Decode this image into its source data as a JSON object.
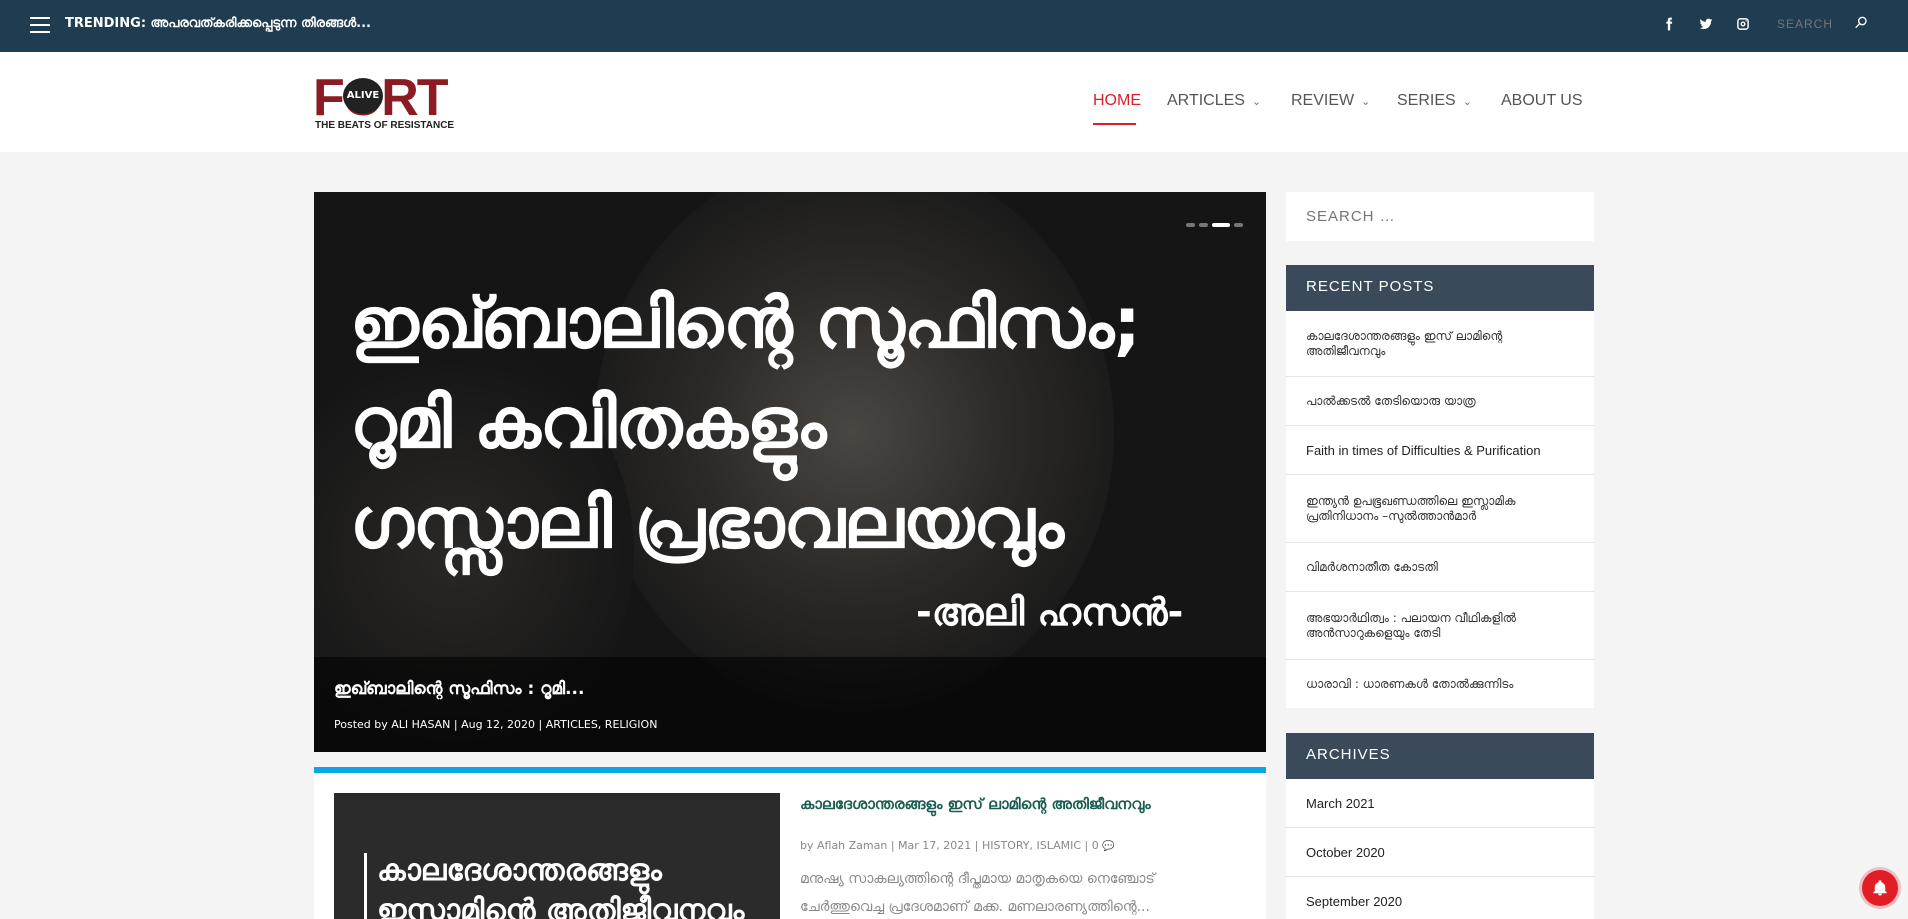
{
  "topbar": {
    "trending": "TRENDING: അപരവത്കരിക്കപ്പെടുന്ന തിരങ്ങൾ...",
    "social": [
      "facebook-icon",
      "twitter-icon",
      "instagram-icon"
    ],
    "search_placeholder": "SEARCH"
  },
  "header": {
    "logo": {
      "word": "FORT",
      "badge": "ALIVE",
      "tagline": "THE BEATS OF RESISTANCE"
    },
    "nav": [
      {
        "label": "HOME",
        "active": true,
        "dropdown": false
      },
      {
        "label": "ARTICLES",
        "active": false,
        "dropdown": true
      },
      {
        "label": "REVIEW",
        "active": false,
        "dropdown": true
      },
      {
        "label": "SERIES",
        "active": false,
        "dropdown": true
      },
      {
        "label": "ABOUT US",
        "active": false,
        "dropdown": false
      }
    ]
  },
  "hero": {
    "lines": [
      "ഇഖ്ബാലിന്റെ സൂഫിസം;",
      "റൂമി കവിതകളും",
      "ഗസ്സാലി പ്രഭാവലയവും"
    ],
    "author_art": "-അലി ഹസൻ-",
    "caption_title": "ഇഖ്ബാലിന്റെ സൂഫിസം : റൂമി...",
    "caption_meta": "Posted by ALI HASAN | Aug 12, 2020 | ARTICLES, RELIGION",
    "slides": 4,
    "active_slide": 3
  },
  "post": {
    "thumb_line1": "കാലദേശാന്തരങ്ങളും",
    "thumb_line2": "ഇസ്ലാമിന്റെ അതിജീവനവും",
    "title": "കാലദേശാന്തരങ്ങളും ഇസ് ലാമിന്റെ അതിജീവനവും",
    "meta": "by Aflah Zaman | Mar 17, 2021 | HISTORY, ISLAMIC | 0",
    "excerpt": "മനുഷ്യ സാകല്യത്തിന്റെ ദീപ്തമായ മാതൃകയെ നെഞ്ചോട് ചേർത്തുവെച്ച പ്രദേശമാണ് മക്ക. മണലാരണ്യത്തിന്റെ..."
  },
  "sidebar": {
    "search_placeholder": "SEARCH …",
    "recent_title": "RECENT POSTS",
    "recent": [
      "കാലദേശാന്തരങ്ങളും ഇസ് ലാമിന്റെ അതിജീവനവും",
      "പാൽക്കടൽ തേടിയൊരു യാത്ര",
      "Faith in times of Difficulties & Purification",
      "ഇന്ത്യൻ ഉപഭൂഖണ്ഡത്തിലെ ഇസ്ലാമിക പ്രതിനിധാനം –സുൽത്താൻമാർ",
      "വിമർശനാതീത കോടതി",
      "അഭയാർഥിത്വം : പലായന വീഥികളിൽ അൻസാറുകളെയും തേടി",
      "ധാരാവി : ധാരണകൾ തോൽക്കുന്നിടം"
    ],
    "archives_title": "ARCHIVES",
    "archives": [
      "March 2021",
      "October 2020",
      "September 2020"
    ]
  },
  "colors": {
    "topbar": "#203c50",
    "accent": "#d9202a",
    "post_border": "#0ca6e8",
    "widget_head": "#3a4a5b"
  }
}
